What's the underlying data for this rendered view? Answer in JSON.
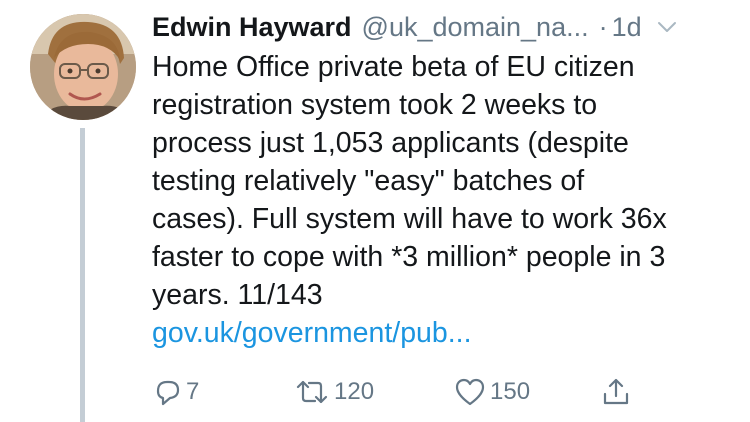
{
  "tweet": {
    "author": {
      "display_name": "Edwin Hayward",
      "handle": "@uk_domain_na...",
      "avatar_icon": "user-avatar-photo"
    },
    "separator": "·",
    "time": "1d",
    "text": "Home Office private beta of EU citizen\nregistration system took 2 weeks to\nprocess just 1,053 applicants (despite\ntesting relatively \"easy\" batches of\ncases). Full system will have to work 36x\nfaster to cope with *3 million* people in 3\nyears. 11/143",
    "link": "gov.uk/government/pub...",
    "actions": {
      "reply": {
        "icon": "reply-icon",
        "count": "7"
      },
      "retweet": {
        "icon": "retweet-icon",
        "count": "120"
      },
      "like": {
        "icon": "heart-icon",
        "count": "150"
      },
      "share": {
        "icon": "share-icon"
      }
    },
    "menu_icon": "chevron-down-icon"
  },
  "colors": {
    "text": "#14171a",
    "secondary": "#657786",
    "link": "#1b95e0",
    "thread_line": "#c4cdd5"
  }
}
